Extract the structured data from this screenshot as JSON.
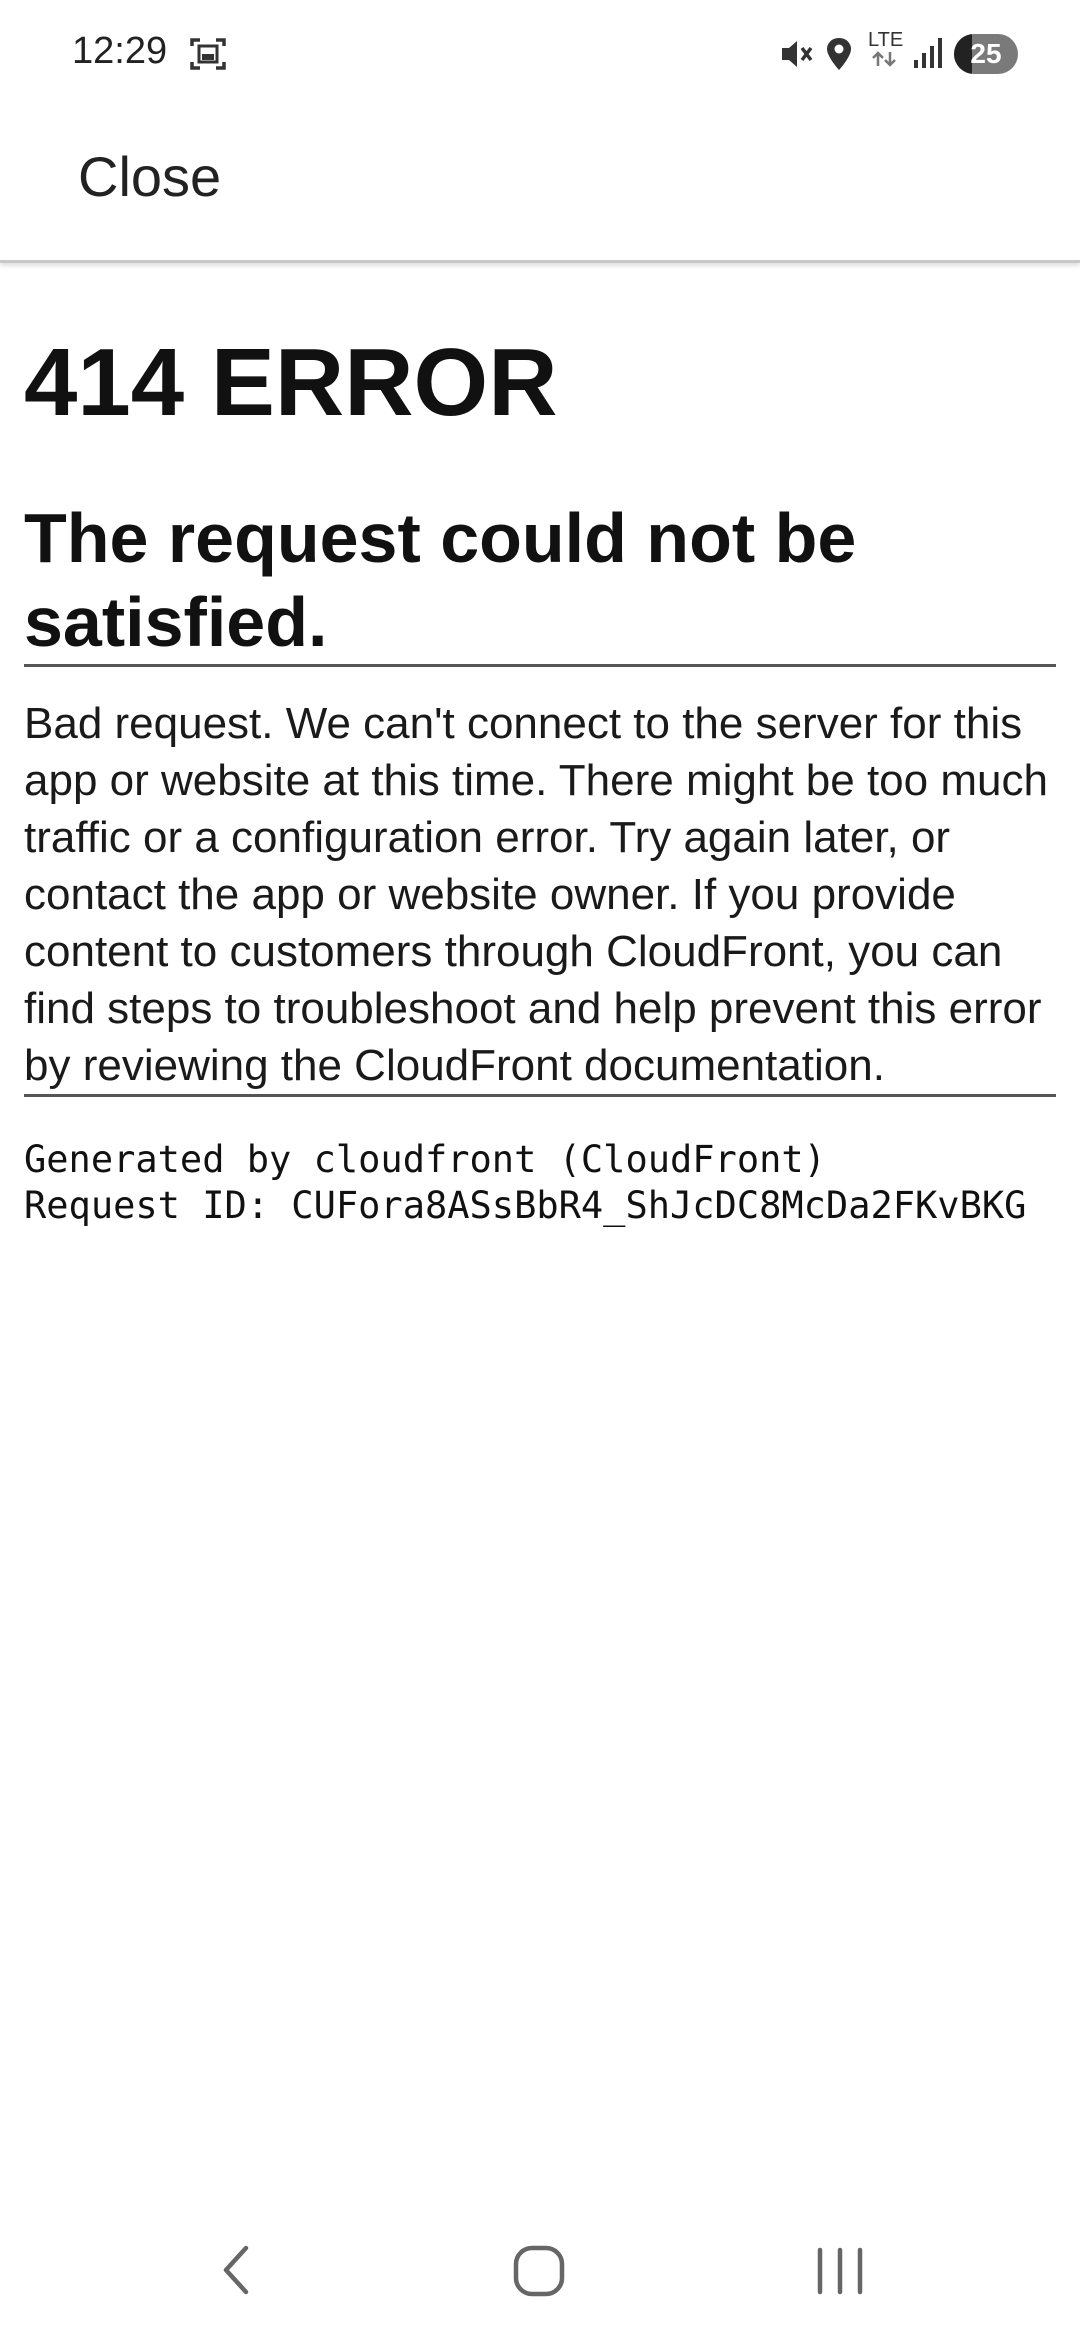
{
  "status_bar": {
    "time": "12:29",
    "network": "LTE",
    "battery": "25"
  },
  "app_bar": {
    "close_label": "Close"
  },
  "error": {
    "title": "414 ERROR",
    "subtitle": "The request could not be satisfied.",
    "body": "Bad request. We can't connect to the server for this app or website at this time. There might be too much traffic or a configuration error. Try again later, or contact the app or website owner. If you provide content to customers through CloudFront, you can find steps to troubleshoot and help prevent this error by reviewing the CloudFront documentation.",
    "generated_by": "Generated by cloudfront (CloudFront)",
    "request_id": "Request ID: CUFora8ASsBbR4_ShJcDC8McDa2FKvBKG"
  },
  "icons": {
    "status": [
      "screenshot-icon",
      "mute-icon",
      "location-icon",
      "lte-icon",
      "signal-icon",
      "battery-icon"
    ],
    "nav": [
      "back-icon",
      "home-icon",
      "recents-icon"
    ]
  }
}
